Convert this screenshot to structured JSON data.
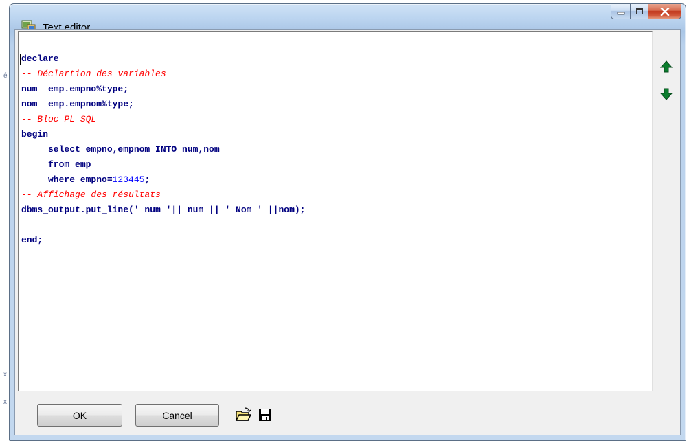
{
  "window": {
    "title": "Text editor"
  },
  "background_marks": [
    "é",
    "x",
    "x"
  ],
  "editor": {
    "lines": [
      {
        "text": "declare",
        "type": "code"
      },
      {
        "text": "-- Déclartion des variables",
        "type": "comment"
      },
      {
        "text": "num  emp.empno%type;",
        "type": "code"
      },
      {
        "text": "nom  emp.empnom%type;",
        "type": "code"
      },
      {
        "text": "-- Bloc PL SQL",
        "type": "comment"
      },
      {
        "text": "begin",
        "type": "code"
      },
      {
        "text": "     select empno,empnom INTO num,nom",
        "type": "code"
      },
      {
        "text": "     from emp",
        "type": "code"
      },
      {
        "text": "     where empno=",
        "number": "123445",
        "tail": ";",
        "type": "code-number"
      },
      {
        "text": "-- Affichage des résultats",
        "type": "comment"
      },
      {
        "text": "dbms_output.put_line(' num '|| num || ' Nom ' ||nom);",
        "type": "code"
      },
      {
        "text": "",
        "type": "code"
      },
      {
        "text": "end;",
        "type": "code"
      }
    ],
    "colors": {
      "keyword": "#00007f",
      "comment": "#ff0000",
      "number": "#0000ff"
    }
  },
  "side": {
    "up_icon": "arrow-up-icon",
    "down_icon": "arrow-down-icon",
    "arrow_color": "#0b7d2e"
  },
  "buttons": {
    "ok": {
      "accel": "O",
      "rest": "K"
    },
    "cancel": {
      "accel": "C",
      "rest": "ancel"
    }
  },
  "tools": {
    "open_icon": "open-folder-icon",
    "save_icon": "save-disk-icon"
  }
}
